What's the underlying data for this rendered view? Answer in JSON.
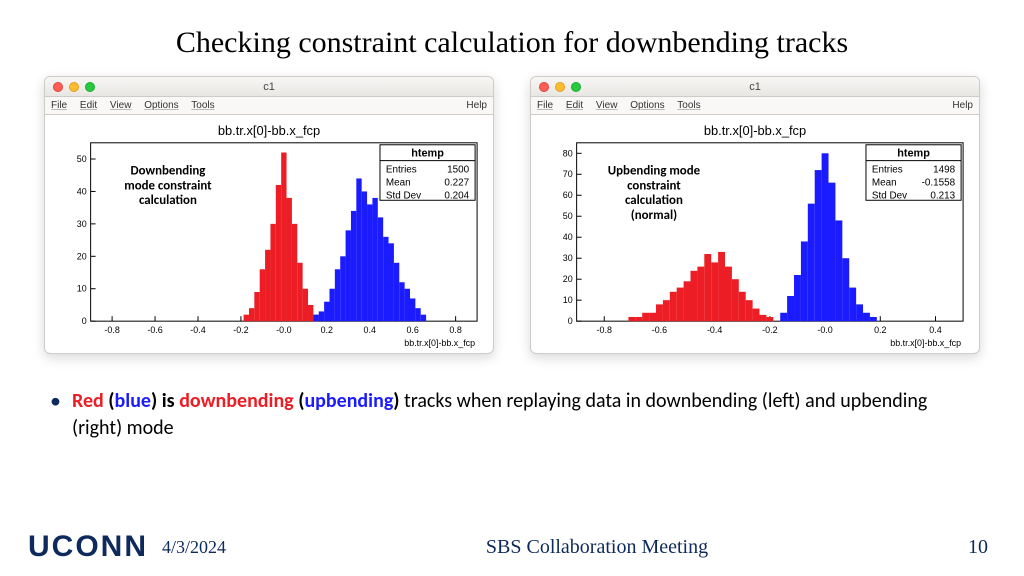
{
  "title": "Checking constraint calculation for downbending tracks",
  "left_plot": {
    "window_title": "c1",
    "menus": [
      "File",
      "Edit",
      "View",
      "Options",
      "Tools"
    ],
    "help": "Help",
    "chart_title": "bb.tr.x[0]-bb.x_fcp",
    "xaxis_title": "bb.tr.x[0]-bb.x_fcp",
    "annotation": [
      "Downbending",
      "mode constraint",
      "calculation"
    ],
    "stats_title": "htemp",
    "stats": {
      "Entries": "1500",
      "Mean": "0.227",
      "Std Dev": "0.204"
    }
  },
  "right_plot": {
    "window_title": "c1",
    "menus": [
      "File",
      "Edit",
      "View",
      "Options",
      "Tools"
    ],
    "help": "Help",
    "chart_title": "bb.tr.x[0]-bb.x_fcp",
    "xaxis_title": "bb.tr.x[0]-bb.x_fcp",
    "annotation": [
      "Upbending mode",
      "constraint",
      "calculation",
      "(normal)"
    ],
    "stats_title": "htemp",
    "stats": {
      "Entries": "1498",
      "Mean": "-0.1558",
      "Std Dev": "0.213"
    }
  },
  "bullet": {
    "red": "Red",
    "lp": " (",
    "blue": "blue",
    "rp": ") ",
    "is": "is ",
    "down": "downbending",
    "lp2": " (",
    "up": "upbending",
    "rp2": ")",
    "rest": " tracks when replaying data in downbending (left) and upbending (right) mode"
  },
  "footer": {
    "logo": "UCONN",
    "date": "4/3/2024",
    "center": "SBS Collaboration Meeting",
    "page": "10"
  },
  "chart_data": [
    {
      "id": "left",
      "type": "bar",
      "title": "bb.tr.x[0]-bb.x_fcp",
      "xlabel": "bb.tr.x[0]-bb.x_fcp",
      "ylabel": "",
      "xlim": [
        -0.9,
        0.9
      ],
      "ylim": [
        0,
        55
      ],
      "yticks": [
        0,
        10,
        20,
        30,
        40,
        50
      ],
      "xticks": [
        -0.8,
        -0.6,
        -0.4,
        -0.2,
        0.0,
        0.2,
        0.4,
        0.6,
        0.8
      ],
      "bin_width": 0.025,
      "series": [
        {
          "name": "downbending tracks (red)",
          "color": "#ec1d24",
          "bins": [
            {
              "x": -0.175,
              "y": 2
            },
            {
              "x": -0.15,
              "y": 4
            },
            {
              "x": -0.125,
              "y": 9
            },
            {
              "x": -0.1,
              "y": 16
            },
            {
              "x": -0.075,
              "y": 22
            },
            {
              "x": -0.05,
              "y": 30
            },
            {
              "x": -0.025,
              "y": 42
            },
            {
              "x": 0.0,
              "y": 52
            },
            {
              "x": 0.025,
              "y": 38
            },
            {
              "x": 0.05,
              "y": 30
            },
            {
              "x": 0.075,
              "y": 18
            },
            {
              "x": 0.1,
              "y": 10
            },
            {
              "x": 0.125,
              "y": 5
            },
            {
              "x": 0.15,
              "y": 2
            }
          ]
        },
        {
          "name": "upbending tracks (blue)",
          "color": "#1b1bff",
          "bins": [
            {
              "x": 0.15,
              "y": 2
            },
            {
              "x": 0.175,
              "y": 3
            },
            {
              "x": 0.2,
              "y": 6
            },
            {
              "x": 0.225,
              "y": 10
            },
            {
              "x": 0.25,
              "y": 16
            },
            {
              "x": 0.275,
              "y": 20
            },
            {
              "x": 0.3,
              "y": 28
            },
            {
              "x": 0.325,
              "y": 34
            },
            {
              "x": 0.35,
              "y": 44
            },
            {
              "x": 0.375,
              "y": 40
            },
            {
              "x": 0.4,
              "y": 36
            },
            {
              "x": 0.425,
              "y": 38
            },
            {
              "x": 0.45,
              "y": 32
            },
            {
              "x": 0.475,
              "y": 26
            },
            {
              "x": 0.5,
              "y": 24
            },
            {
              "x": 0.525,
              "y": 18
            },
            {
              "x": 0.55,
              "y": 12
            },
            {
              "x": 0.575,
              "y": 10
            },
            {
              "x": 0.6,
              "y": 7
            },
            {
              "x": 0.625,
              "y": 4
            },
            {
              "x": 0.65,
              "y": 2
            }
          ]
        }
      ],
      "stats": {
        "Entries": 1500,
        "Mean": 0.227,
        "Std Dev": 0.204
      }
    },
    {
      "id": "right",
      "type": "bar",
      "title": "bb.tr.x[0]-bb.x_fcp",
      "xlabel": "bb.tr.x[0]-bb.x_fcp",
      "ylabel": "",
      "xlim": [
        -0.9,
        0.5
      ],
      "ylim": [
        0,
        85
      ],
      "yticks": [
        0,
        10,
        20,
        30,
        40,
        50,
        60,
        70,
        80
      ],
      "xticks": [
        -0.8,
        -0.6,
        -0.4,
        -0.2,
        0.0,
        0.2,
        0.4
      ],
      "bin_width": 0.025,
      "series": [
        {
          "name": "downbending tracks (red)",
          "color": "#ec1d24",
          "bins": [
            {
              "x": -0.7,
              "y": 2
            },
            {
              "x": -0.675,
              "y": 2
            },
            {
              "x": -0.65,
              "y": 4
            },
            {
              "x": -0.625,
              "y": 4
            },
            {
              "x": -0.6,
              "y": 8
            },
            {
              "x": -0.575,
              "y": 10
            },
            {
              "x": -0.55,
              "y": 14
            },
            {
              "x": -0.525,
              "y": 16
            },
            {
              "x": -0.5,
              "y": 19
            },
            {
              "x": -0.475,
              "y": 24
            },
            {
              "x": -0.45,
              "y": 26
            },
            {
              "x": -0.425,
              "y": 32
            },
            {
              "x": -0.4,
              "y": 28
            },
            {
              "x": -0.375,
              "y": 33
            },
            {
              "x": -0.35,
              "y": 26
            },
            {
              "x": -0.325,
              "y": 20
            },
            {
              "x": -0.3,
              "y": 14
            },
            {
              "x": -0.275,
              "y": 10
            },
            {
              "x": -0.25,
              "y": 6
            },
            {
              "x": -0.225,
              "y": 3
            },
            {
              "x": -0.2,
              "y": 2
            }
          ]
        },
        {
          "name": "upbending tracks (blue)",
          "color": "#1b1bff",
          "bins": [
            {
              "x": -0.15,
              "y": 4
            },
            {
              "x": -0.125,
              "y": 12
            },
            {
              "x": -0.1,
              "y": 22
            },
            {
              "x": -0.075,
              "y": 38
            },
            {
              "x": -0.05,
              "y": 56
            },
            {
              "x": -0.025,
              "y": 72
            },
            {
              "x": 0.0,
              "y": 80
            },
            {
              "x": 0.025,
              "y": 66
            },
            {
              "x": 0.05,
              "y": 48
            },
            {
              "x": 0.075,
              "y": 30
            },
            {
              "x": 0.1,
              "y": 16
            },
            {
              "x": 0.125,
              "y": 8
            },
            {
              "x": 0.15,
              "y": 4
            },
            {
              "x": 0.175,
              "y": 2
            }
          ]
        }
      ],
      "stats": {
        "Entries": 1498,
        "Mean": -0.1558,
        "Std Dev": 0.213
      }
    }
  ]
}
